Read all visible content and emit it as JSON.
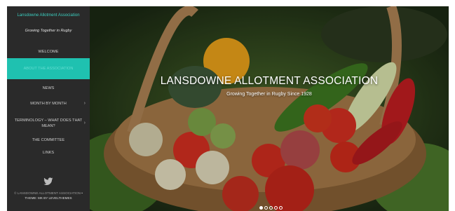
{
  "site": {
    "title": "Lansdowne Allotment Association",
    "tagline": "Growing Together in Rugby"
  },
  "nav": {
    "items": [
      {
        "label": "WELCOME",
        "has_children": false,
        "active": false
      },
      {
        "label": "ABOUT THE ASSOCIATION",
        "has_children": false,
        "active": true
      },
      {
        "label": "NEWS",
        "has_children": false,
        "active": false
      },
      {
        "label": "MONTH BY MONTH",
        "has_children": true,
        "active": false
      },
      {
        "label": "TERMINOLOGY – WHAT DOES THAT MEAN?",
        "has_children": true,
        "active": false
      },
      {
        "label": "THE COMMITTEE",
        "has_children": false,
        "active": false
      },
      {
        "label": "LINKS",
        "has_children": false,
        "active": false
      }
    ]
  },
  "social": {
    "icon": "twitter-icon"
  },
  "footer": {
    "copyright": "© LANSDOWNE ALLOTMENT ASSOCIATION",
    "separator": "•",
    "theme_credit": "THEME: MK BY LEVELTHEMES"
  },
  "hero": {
    "title": "LANSDOWNE ALLOTMENT ASSOCIATION",
    "subtitle": "Growing Together in Rugby Since 1928",
    "slides_total": 5,
    "slide_active": 1
  },
  "colors": {
    "accent": "#1fc1b0",
    "sidebar_bg": "#2a2a2a"
  }
}
